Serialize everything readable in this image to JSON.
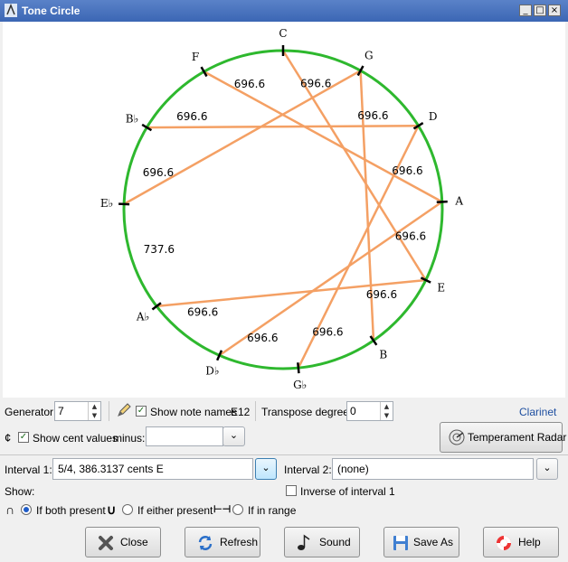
{
  "window": {
    "title": "Tone Circle",
    "minimize": "_",
    "maximize": "□",
    "close": "×"
  },
  "circle": {
    "notes": [
      {
        "name": "C",
        "angle": 0
      },
      {
        "name": "G",
        "angle": 29.1
      },
      {
        "name": "D",
        "angle": 58.2
      },
      {
        "name": "A",
        "angle": 87.2
      },
      {
        "name": "E",
        "angle": 116.3
      },
      {
        "name": "B",
        "angle": 145.4
      },
      {
        "name": "G♭",
        "angle": 174.5
      },
      {
        "name": "D♭",
        "angle": 203.6
      },
      {
        "name": "A♭",
        "angle": 232.6
      },
      {
        "name": "E♭",
        "angle": 272.0
      },
      {
        "name": "B♭",
        "angle": 301.1
      },
      {
        "name": "F",
        "angle": 330.2
      }
    ],
    "gap_labels": [
      "696.6",
      "696.6",
      "696.6",
      "696.6",
      "696.6",
      "696.6",
      "696.6",
      "696.6",
      "737.6",
      "696.6",
      "696.6",
      "696.6"
    ],
    "chords": [
      [
        0,
        4
      ],
      [
        1,
        5
      ],
      [
        2,
        6
      ],
      [
        3,
        7
      ],
      [
        4,
        8
      ],
      [
        1,
        9
      ],
      [
        2,
        10
      ],
      [
        3,
        11
      ]
    ],
    "colors": {
      "circle": "#2eb82e",
      "chord": "#f4a064",
      "tick": "#000000"
    }
  },
  "controls": {
    "generator_label": "Generator:",
    "generator_value": "7",
    "show_note_names_label": "Show note names",
    "edo_label": "E12",
    "transpose_label": "Transpose degree:",
    "transpose_value": "0",
    "instrument": "Clarinet",
    "cent_symbol": "¢",
    "show_cent_values_label": "Show cent values",
    "minus_label": "minus:",
    "minus_value": "",
    "temperament_radar_label": "Temperament Radar",
    "interval1_label": "Interval 1:",
    "interval1_value": "5/4, 386.3137 cents   E",
    "interval2_label": "Interval 2:",
    "interval2_value": "(none)",
    "inverse_label": "Inverse of interval 1",
    "show_label": "Show:",
    "both_symbol": "∩",
    "both_label": "If both present",
    "either_symbol": "∪",
    "either_label": "If either present",
    "range_symbol": "⊢⊣",
    "range_label": "If in range"
  },
  "buttons": {
    "close": "Close",
    "refresh": "Refresh",
    "sound": "Sound",
    "save_as": "Save As",
    "help": "Help"
  }
}
